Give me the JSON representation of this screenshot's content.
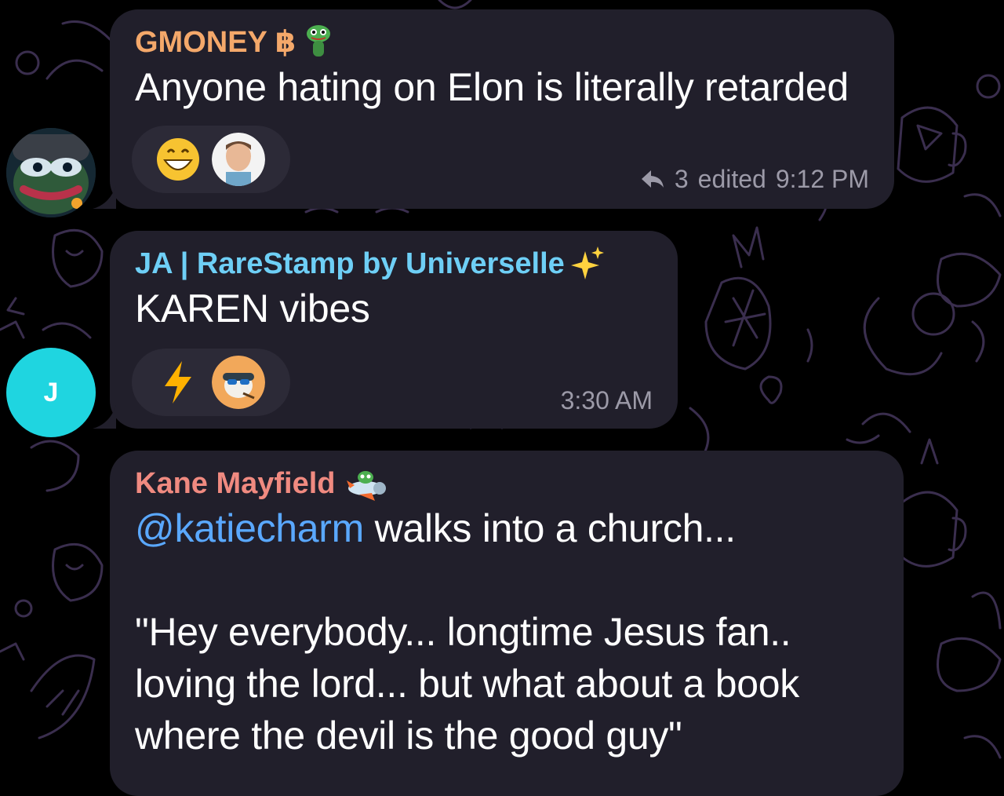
{
  "chat": {
    "messages": [
      {
        "sender": "GMONEY ฿",
        "sender_color": "#f4a86a",
        "text": "Anyone hating on Elon is literally retarded",
        "reactions": [
          "grinning-face-emoji",
          "user-avatar"
        ],
        "reply_count": "3",
        "edited_label": "edited",
        "time": "9:12 PM",
        "avatar": "pepe-avatar"
      },
      {
        "sender": "JA | RareStamp by Universelle",
        "sender_color": "#6ecff6",
        "text": "KAREN vibes",
        "reactions": [
          "lightning-emoji",
          "user-avatar"
        ],
        "time": "3:30 AM",
        "avatar_letter": "J",
        "avatar_color": "#1fd5e0"
      },
      {
        "sender": "Kane Mayfield",
        "sender_color": "#f08a80",
        "mention": "@katiecharm",
        "text_after_mention": " walks into a church...",
        "lines": [
          "\"Hey everybody... longtime Jesus fan..",
          "loving the lord... but what about a book",
          "where the devil is the good guy\""
        ]
      }
    ]
  }
}
